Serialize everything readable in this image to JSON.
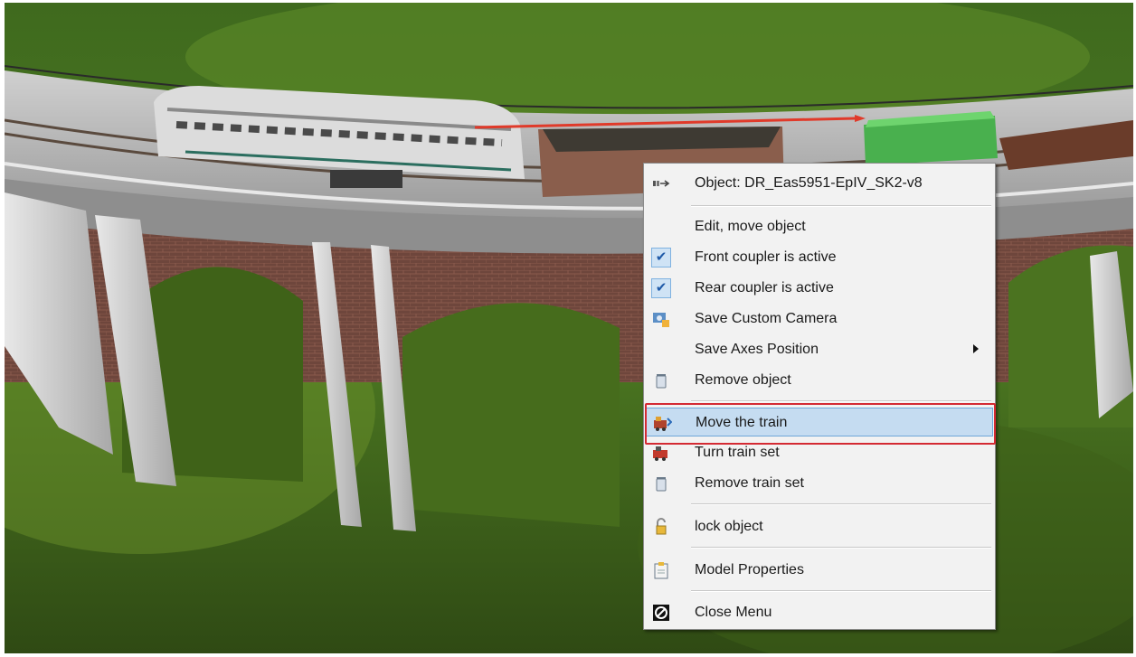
{
  "scene": {
    "description_icons": [
      "locomotive-model",
      "hopper-wagon",
      "green-wagon",
      "flat-wagon",
      "viaduct"
    ],
    "colors": {
      "grass": "#4f7a1e",
      "highlight": "#d42a33",
      "selection": "#c5dcf1"
    }
  },
  "menu": {
    "header": {
      "icon": "object-arrow-icon",
      "label": "Object: DR_Eas5951-EpIV_SK2-v8"
    },
    "items": [
      {
        "icon": "",
        "label": "Edit, move object"
      },
      {
        "icon": "checkmark-icon",
        "label": "Front coupler is active",
        "checked": true
      },
      {
        "icon": "checkmark-icon",
        "label": "Rear coupler is active",
        "checked": true
      },
      {
        "icon": "camera-save-icon",
        "label": "Save Custom Camera"
      },
      {
        "icon": "",
        "label": "Save Axes Position",
        "submenu": true
      },
      {
        "icon": "trash-icon",
        "label": "Remove object"
      },
      {
        "icon": "move-train-icon",
        "label": "Move the train",
        "selected": true
      },
      {
        "icon": "turn-train-icon",
        "label": "Turn train set"
      },
      {
        "icon": "trash-icon",
        "label": "Remove train set"
      },
      {
        "icon": "lock-icon",
        "label": "lock object"
      },
      {
        "icon": "clipboard-icon",
        "label": "Model Properties"
      },
      {
        "icon": "close-circle-icon",
        "label": "Close Menu"
      }
    ]
  }
}
